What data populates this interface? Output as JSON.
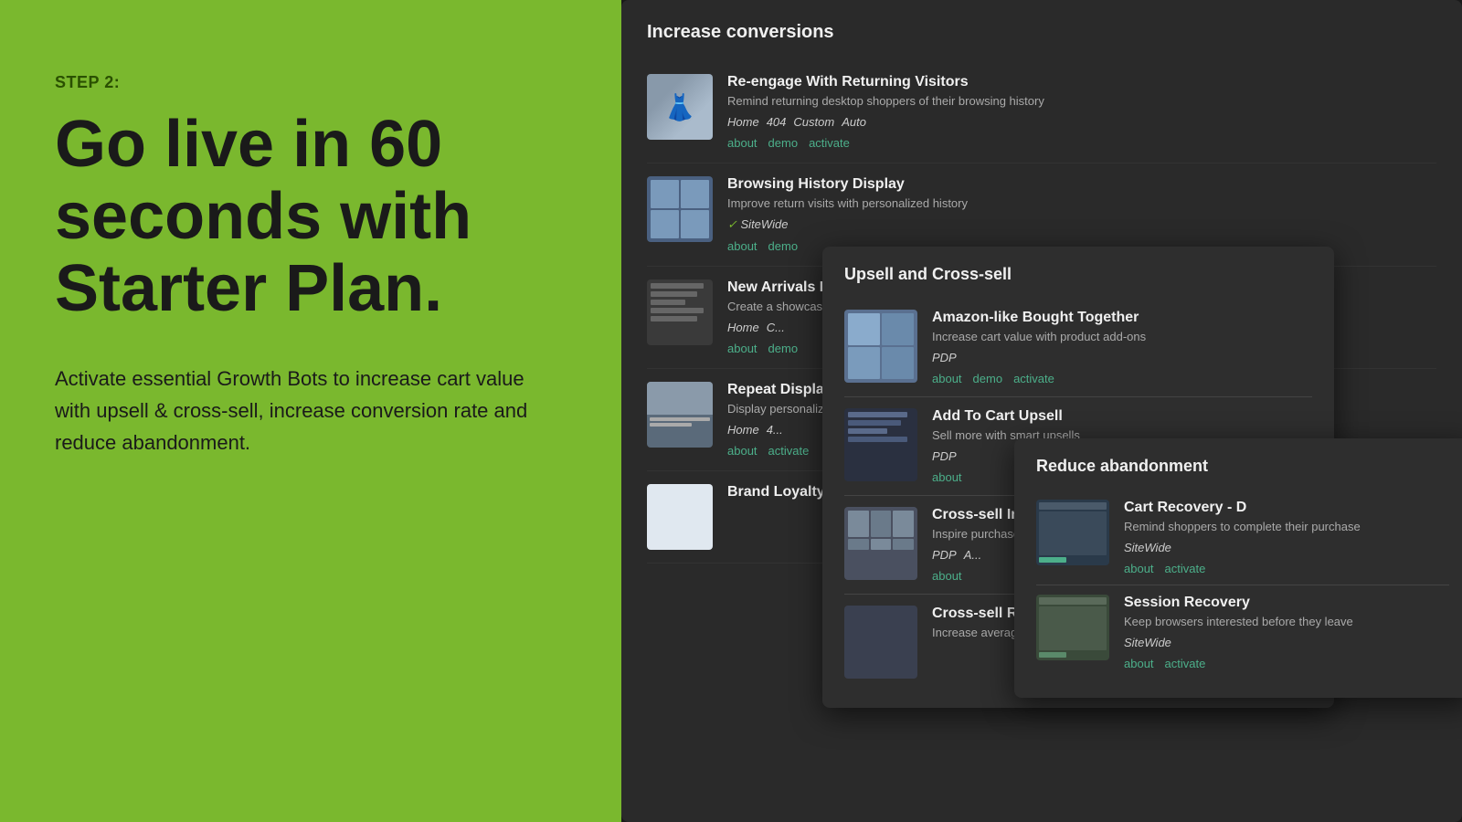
{
  "left": {
    "step_label": "STEP 2:",
    "heading": "Go live in 60 seconds with Starter Plan.",
    "subtext": "Activate essential Growth Bots to increase cart value with upsell & cross-sell, increase conversion rate and reduce abandonment."
  },
  "right": {
    "section_title": "Increase conversions",
    "bots": [
      {
        "id": "reengage",
        "name": "Re-engage With Returning Visitors",
        "desc": "Remind returning desktop shoppers of their browsing history",
        "tags": [
          "Home",
          "404",
          "Custom",
          "Auto"
        ],
        "actions": [
          "about",
          "demo",
          "activate"
        ]
      },
      {
        "id": "browsing",
        "name": "Browsing...",
        "desc": "Improve...",
        "tags_check": [
          "SiteWide"
        ],
        "actions": [
          "about",
          "de..."
        ]
      },
      {
        "id": "newarr",
        "name": "New Arr...",
        "desc": "Create a...",
        "tags": [
          "Home",
          "C..."
        ],
        "actions": [
          "about",
          "de..."
        ]
      },
      {
        "id": "repeat",
        "name": "Repeat Display E",
        "desc": "Display p...",
        "tags": [
          "Home",
          "4..."
        ],
        "actions": [
          "about",
          "ac..."
        ]
      },
      {
        "id": "brand",
        "name": "Brand L...",
        "desc": "",
        "tags": [],
        "actions": []
      }
    ],
    "overlay_upsell": {
      "title": "Upsell and Cross-sell",
      "bots": [
        {
          "id": "amazon-bought",
          "name": "Amazon-like Bought Together",
          "desc": "Increase cart value with product add-ons",
          "tags": [
            "PDP"
          ],
          "actions": [
            "about",
            "demo",
            "activate"
          ]
        },
        {
          "id": "add-t",
          "name": "Add T...",
          "desc": "Sell mo...",
          "tags": [
            "PDP"
          ],
          "actions": [
            "about"
          ]
        },
        {
          "id": "cross1",
          "name": "Cross-...",
          "desc": "Inspire...",
          "tags": [
            "PDP",
            "A..."
          ],
          "actions": [
            "about"
          ]
        },
        {
          "id": "cross2",
          "name": "Cross-...",
          "desc": "Increa...",
          "tags": [],
          "actions": []
        }
      ]
    },
    "overlay_reduce": {
      "title": "Reduce abandonment",
      "bots": [
        {
          "id": "cart-recovery",
          "name": "Cart Recovery - D",
          "desc": "Remind shoppers to...",
          "tags": [
            "SiteWide"
          ],
          "actions": [
            "about",
            "activate"
          ]
        },
        {
          "id": "session-recovery",
          "name": "Session Recovery",
          "desc": "Keep browsers inte...",
          "tags": [
            "SiteWide"
          ],
          "actions": [
            "about",
            "activate"
          ]
        }
      ]
    }
  }
}
